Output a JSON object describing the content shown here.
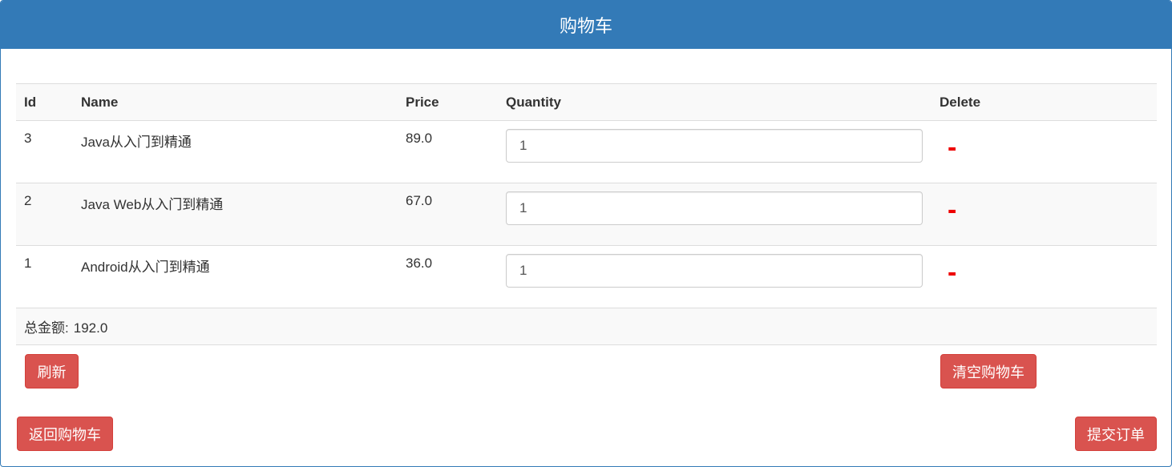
{
  "panel": {
    "title": "购物车"
  },
  "table": {
    "headers": {
      "id": "Id",
      "name": "Name",
      "price": "Price",
      "quantity": "Quantity",
      "delete": "Delete"
    },
    "rows": [
      {
        "id": "3",
        "name": "Java从入门到精通",
        "price": "89.0",
        "quantity": "1",
        "delete": "-"
      },
      {
        "id": "2",
        "name": "Java Web从入门到精通",
        "price": "67.0",
        "quantity": "1",
        "delete": "-"
      },
      {
        "id": "1",
        "name": "Android从入门到精通",
        "price": "36.0",
        "quantity": "1",
        "delete": "-"
      }
    ],
    "total": {
      "label": "总金额:",
      "value": "192.0"
    }
  },
  "actions": {
    "refresh_label": "刷新",
    "clear_label": "清空购物车",
    "back_label": "返回购物车",
    "submit_label": "提交订单"
  },
  "colors": {
    "primary": "#337ab7",
    "danger": "#d9534f",
    "delete_mark": "#ee0000"
  }
}
